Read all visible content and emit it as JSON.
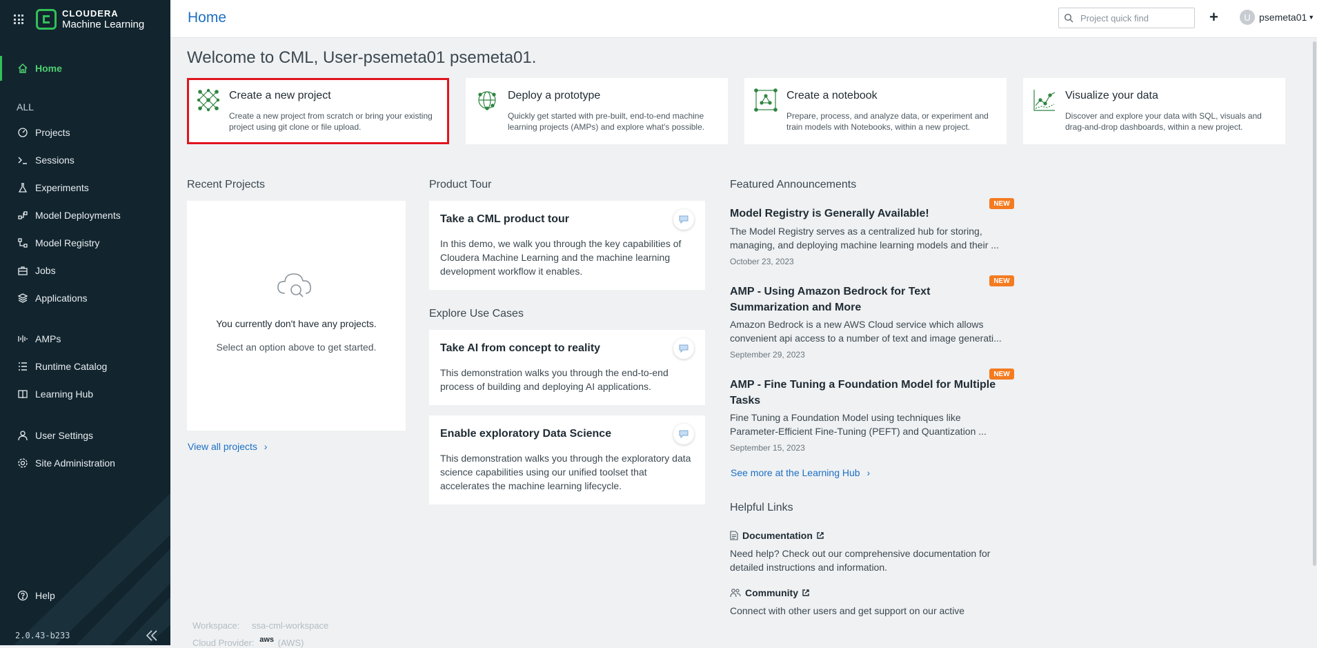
{
  "brand": {
    "line1": "CLOUDERA",
    "line2": "Machine Learning"
  },
  "header": {
    "title": "Home",
    "search_placeholder": "Project quick find",
    "avatar_initial": "U",
    "username": "psemeta01"
  },
  "sidebar": {
    "home": "Home",
    "section": "ALL",
    "items": [
      "Projects",
      "Sessions",
      "Experiments",
      "Model Deployments",
      "Model Registry",
      "Jobs",
      "Applications",
      "AMPs",
      "Runtime Catalog",
      "Learning Hub",
      "User Settings",
      "Site Administration"
    ],
    "help": "Help",
    "version": "2.0.43-b233"
  },
  "welcome": "Welcome to CML, User-psemeta01 psemeta01.",
  "quick_actions": [
    {
      "title": "Create a new project",
      "desc": "Create a new project from scratch or bring your existing project using git clone or file upload."
    },
    {
      "title": "Deploy a prototype",
      "desc": "Quickly get started with pre-built, end-to-end machine learning projects (AMPs) and explore what's possible."
    },
    {
      "title": "Create a notebook",
      "desc": "Prepare, process, and analyze data, or experiment and train models with Notebooks, within a new project."
    },
    {
      "title": "Visualize your data",
      "desc": "Discover and explore your data with SQL, visuals and drag-and-drop dashboards, within a new project."
    }
  ],
  "recent": {
    "title": "Recent Projects",
    "empty1": "You currently don't have any projects.",
    "empty2": "Select an option above to get started.",
    "view_all": "View all projects"
  },
  "tour": {
    "title": "Product Tour",
    "card": {
      "title": "Take a CML product tour",
      "desc": "In this demo, we walk you through the key capabilities of Cloudera Machine Learning and the machine learning development workflow it enables."
    }
  },
  "use_cases": {
    "title": "Explore Use Cases",
    "cards": [
      {
        "title": "Take AI from concept to reality",
        "desc": "This demonstration walks you through the end-to-end process of building and deploying AI applications."
      },
      {
        "title": "Enable exploratory Data Science",
        "desc": "This demonstration walks you through the exploratory data science capabilities using our unified toolset that accelerates the machine learning lifecycle."
      }
    ]
  },
  "announcements": {
    "title": "Featured Announcements",
    "badge": "NEW",
    "items": [
      {
        "title": "Model Registry is Generally Available!",
        "desc": "The Model Registry serves as a centralized hub for storing, managing, and deploying machine learning models and their ...",
        "date": "October 23, 2023"
      },
      {
        "title": "AMP - Using Amazon Bedrock for Text Summarization and More",
        "desc": "Amazon Bedrock is a new AWS Cloud service which allows convenient api access to a number of text and image generati...",
        "date": "September 29, 2023"
      },
      {
        "title": "AMP - Fine Tuning a Foundation Model for Multiple Tasks",
        "desc": "Fine Tuning a Foundation Model using techniques like Parameter-Efficient Fine-Tuning (PEFT) and Quantization ...",
        "date": "September 15, 2023"
      }
    ],
    "see_more": "See more at the Learning Hub"
  },
  "helpful_links": {
    "title": "Helpful Links",
    "documentation": {
      "title": "Documentation",
      "desc": "Need help? Check out our comprehensive documentation for detailed instructions and information."
    },
    "community": {
      "title": "Community",
      "desc": "Connect with other users and get support on our active"
    }
  },
  "footer": {
    "workspace_label": "Workspace:",
    "workspace_value": "ssa-cml-workspace",
    "provider_label": "Cloud Provider:",
    "provider_logo": "aws",
    "provider_value": "(AWS)"
  },
  "colors": {
    "sidebar_bg": "#12252f",
    "accent_green": "#33c058",
    "link_blue": "#1d6fc3",
    "badge_orange": "#f47b20",
    "selection_red": "#e0141e"
  }
}
